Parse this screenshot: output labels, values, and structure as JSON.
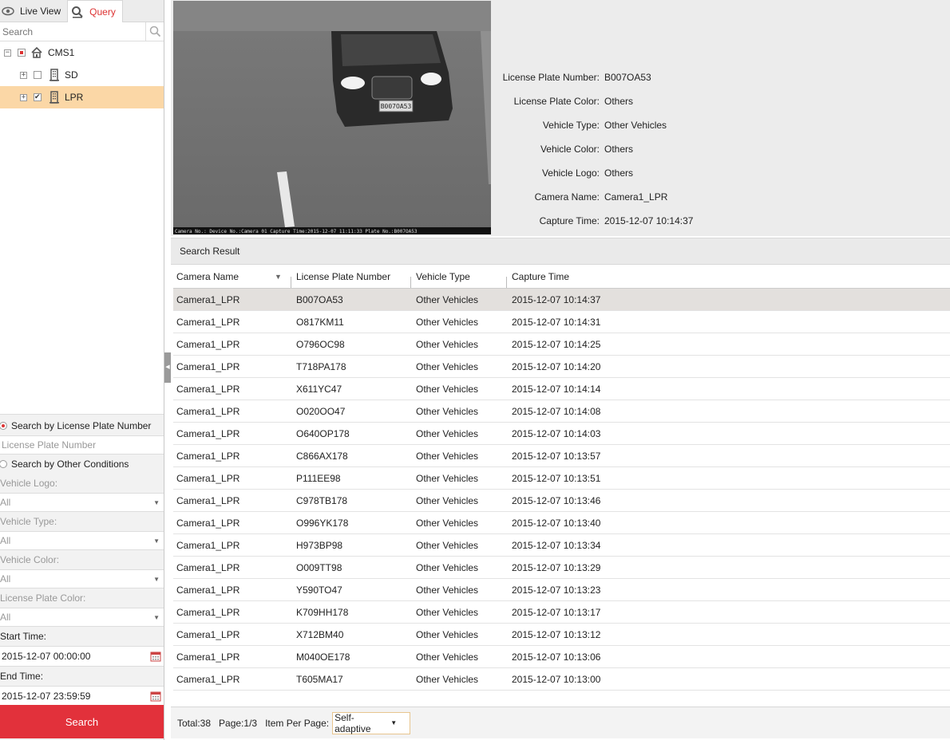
{
  "tabs": {
    "live_view": "Live View",
    "query": "Query"
  },
  "search": {
    "placeholder": "Search"
  },
  "tree": {
    "root": "CMS1",
    "children": [
      {
        "label": "SD",
        "checked": false
      },
      {
        "label": "LPR",
        "checked": true,
        "selected": true
      }
    ]
  },
  "conditions": {
    "by_plate_label": "Search by License Plate Number",
    "plate_placeholder": "License Plate Number",
    "by_other_label": "Search by Other Conditions",
    "vehicle_logo_label": "Vehicle Logo:",
    "vehicle_logo_value": "All",
    "vehicle_type_label": "Vehicle Type:",
    "vehicle_type_value": "All",
    "vehicle_color_label": "Vehicle Color:",
    "vehicle_color_value": "All",
    "plate_color_label": "License Plate Color:",
    "plate_color_value": "All",
    "start_time_label": "Start Time:",
    "start_time_value": "2015-12-07 00:00:00",
    "end_time_label": "End Time:",
    "end_time_value": "2015-12-07 23:59:59",
    "search_button": "Search"
  },
  "preview": {
    "overlay_text": "Camera No.: Device No.:Camera 01 Capture Time:2015-12-07 11:11:33 Plate No.:B007OA53",
    "plate_text": "B007OA53",
    "details": [
      {
        "label": "License Plate Number:",
        "value": "B007OA53"
      },
      {
        "label": "License Plate Color:",
        "value": "Others"
      },
      {
        "label": "Vehicle Type:",
        "value": "Other Vehicles"
      },
      {
        "label": "Vehicle Color:",
        "value": "Others"
      },
      {
        "label": "Vehicle Logo:",
        "value": "Others"
      },
      {
        "label": "Camera Name:",
        "value": "Camera1_LPR"
      },
      {
        "label": "Capture Time:",
        "value": "2015-12-07 10:14:37"
      }
    ]
  },
  "result": {
    "title": "Search Result",
    "columns": [
      "Camera Name",
      "License Plate Number",
      "Vehicle Type",
      "Capture Time"
    ],
    "rows": [
      [
        "Camera1_LPR",
        "B007OA53",
        "Other Vehicles",
        "2015-12-07 10:14:37"
      ],
      [
        "Camera1_LPR",
        "O817KM11",
        "Other Vehicles",
        "2015-12-07 10:14:31"
      ],
      [
        "Camera1_LPR",
        "O796OC98",
        "Other Vehicles",
        "2015-12-07 10:14:25"
      ],
      [
        "Camera1_LPR",
        "T718PA178",
        "Other Vehicles",
        "2015-12-07 10:14:20"
      ],
      [
        "Camera1_LPR",
        "X611YC47",
        "Other Vehicles",
        "2015-12-07 10:14:14"
      ],
      [
        "Camera1_LPR",
        "O020OO47",
        "Other Vehicles",
        "2015-12-07 10:14:08"
      ],
      [
        "Camera1_LPR",
        "O640OP178",
        "Other Vehicles",
        "2015-12-07 10:14:03"
      ],
      [
        "Camera1_LPR",
        "C866AX178",
        "Other Vehicles",
        "2015-12-07 10:13:57"
      ],
      [
        "Camera1_LPR",
        "P111EE98",
        "Other Vehicles",
        "2015-12-07 10:13:51"
      ],
      [
        "Camera1_LPR",
        "C978TB178",
        "Other Vehicles",
        "2015-12-07 10:13:46"
      ],
      [
        "Camera1_LPR",
        "O996YK178",
        "Other Vehicles",
        "2015-12-07 10:13:40"
      ],
      [
        "Camera1_LPR",
        "H973BP98",
        "Other Vehicles",
        "2015-12-07 10:13:34"
      ],
      [
        "Camera1_LPR",
        "O009TT98",
        "Other Vehicles",
        "2015-12-07 10:13:29"
      ],
      [
        "Camera1_LPR",
        "Y590TO47",
        "Other Vehicles",
        "2015-12-07 10:13:23"
      ],
      [
        "Camera1_LPR",
        "K709HH178",
        "Other Vehicles",
        "2015-12-07 10:13:17"
      ],
      [
        "Camera1_LPR",
        "X712BM40",
        "Other Vehicles",
        "2015-12-07 10:13:12"
      ],
      [
        "Camera1_LPR",
        "M040OE178",
        "Other Vehicles",
        "2015-12-07 10:13:06"
      ],
      [
        "Camera1_LPR",
        "T605MA17",
        "Other Vehicles",
        "2015-12-07 10:13:00"
      ]
    ],
    "selected_index": 0
  },
  "footer": {
    "total": "Total:38",
    "page": "Page:1/3",
    "per_page_label": "Item Per Page:",
    "per_page_value": "Self-adaptive"
  },
  "colors": {
    "accent": "#e2313b",
    "selected_tree": "#fbd7a6",
    "selected_row": "#e3e0dd"
  }
}
